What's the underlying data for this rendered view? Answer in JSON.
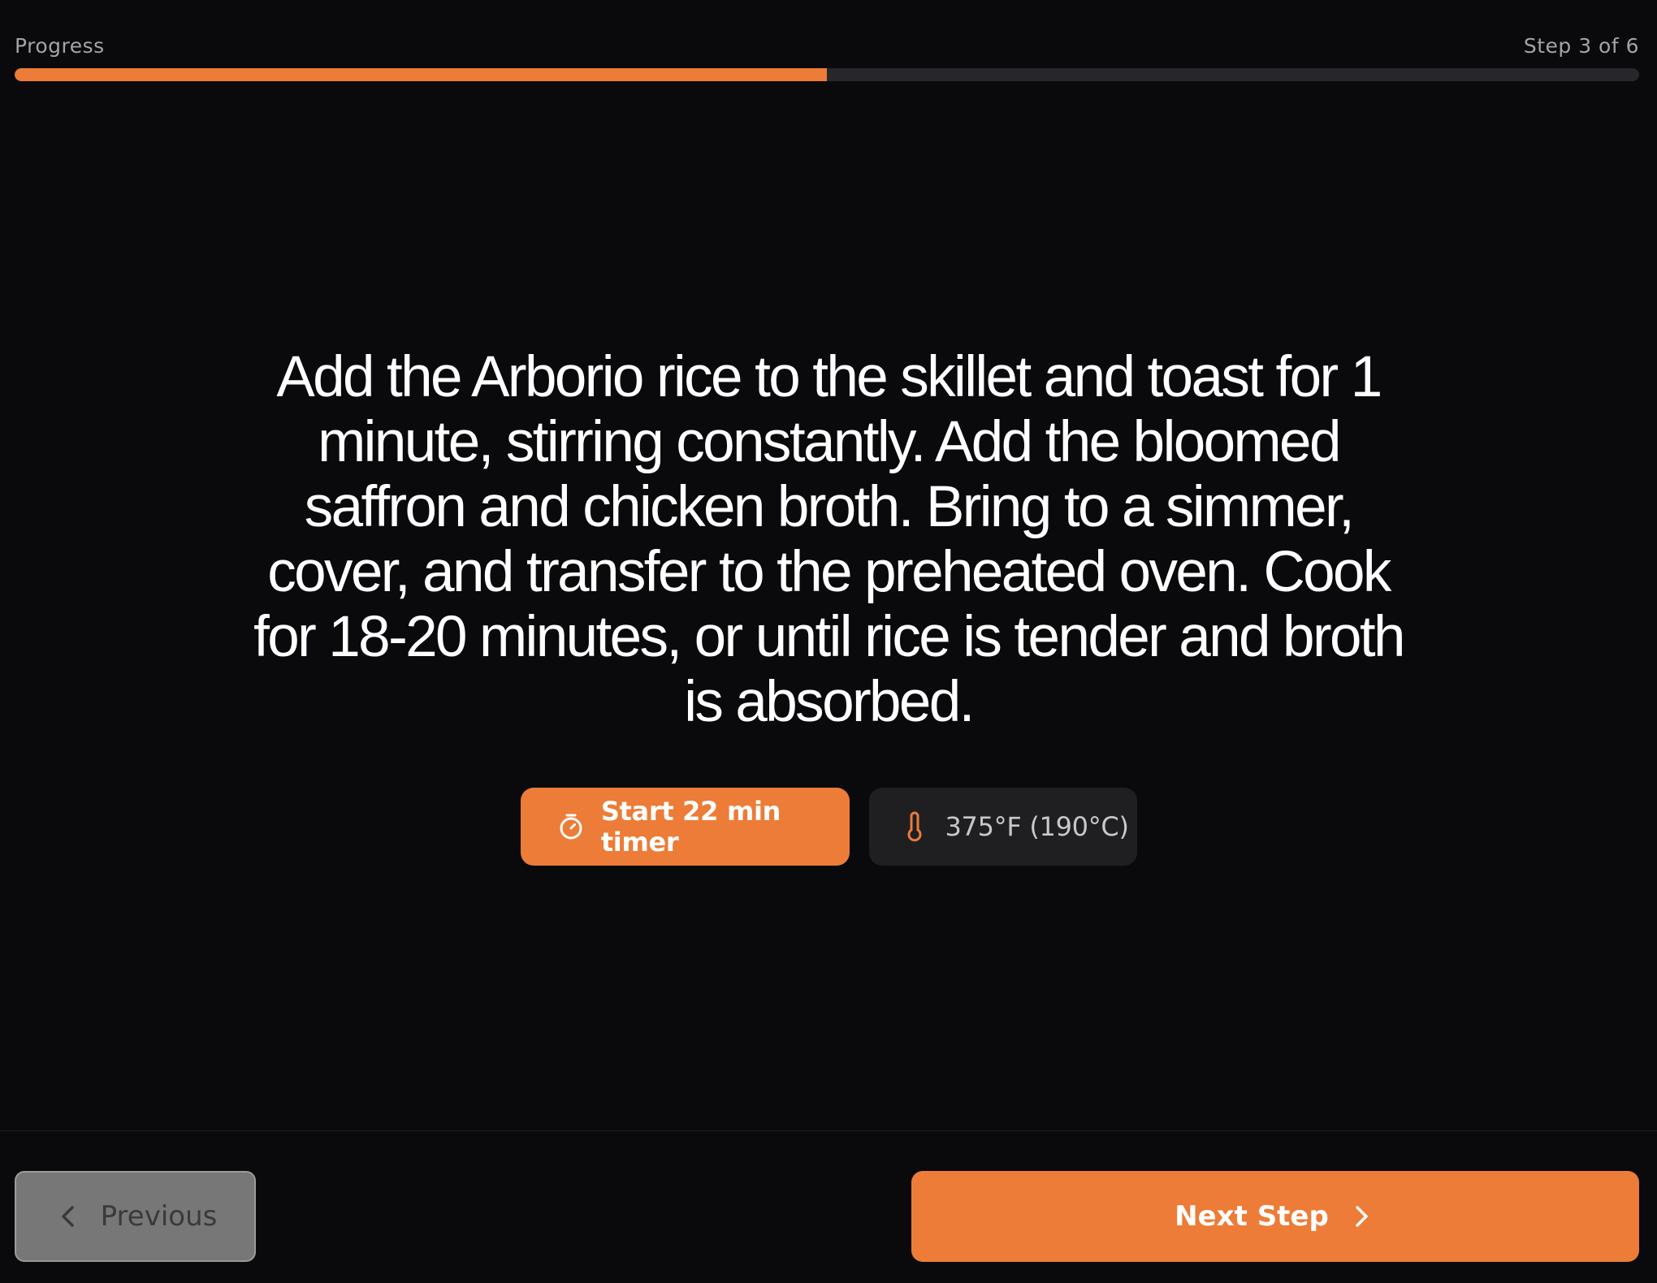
{
  "progress": {
    "label": "Progress",
    "step_text": "Step 3 of 6",
    "current_step": 3,
    "total_steps": 6,
    "fraction": 0.5,
    "fill_color": "#ec7c37",
    "track_color": "#27272b"
  },
  "instruction": {
    "text": "Add the Arborio rice to the skillet and toast for 1 minute, stirring constantly. Add the bloomed saffron and chicken broth. Bring to a simmer, cover, and transfer to the preheated oven. Cook for 18-20 minutes, or until rice is tender and broth is absorbed."
  },
  "chips": {
    "timer": {
      "label": "Start 22 min timer",
      "icon": "stopwatch-icon"
    },
    "temperature": {
      "label": "375°F (190°C)",
      "icon": "thermometer-icon"
    }
  },
  "navigation": {
    "previous_label": "Previous",
    "previous_icon": "chevron-left-icon",
    "next_label": "Next Step",
    "next_icon": "chevron-right-icon"
  },
  "colors": {
    "accent": "#ec7c37",
    "background": "#0a0a0c"
  }
}
